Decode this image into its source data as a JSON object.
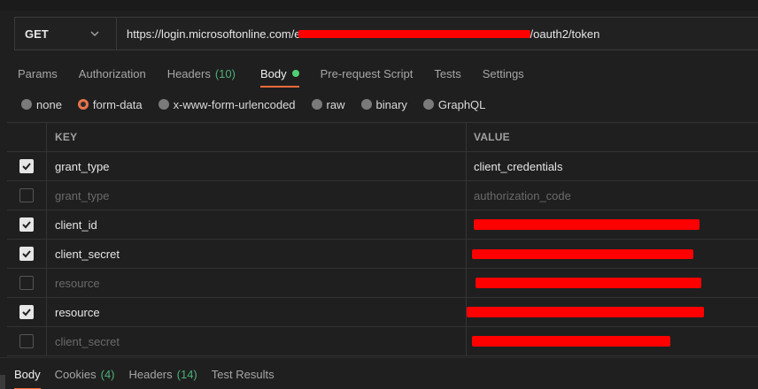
{
  "request": {
    "method": "GET",
    "url_prefix": "https://login.microsoftonline.com/e",
    "url_suffix": "/oauth2/token"
  },
  "tabs": [
    {
      "label": "Params"
    },
    {
      "label": "Authorization"
    },
    {
      "label": "Headers",
      "count": "(10)"
    },
    {
      "label": "Body"
    },
    {
      "label": "Pre-request Script"
    },
    {
      "label": "Tests"
    },
    {
      "label": "Settings"
    }
  ],
  "body_types": {
    "none": "none",
    "form_data": "form-data",
    "urlencoded": "x-www-form-urlencoded",
    "raw": "raw",
    "binary": "binary",
    "graphql": "GraphQL"
  },
  "table": {
    "key_header": "KEY",
    "value_header": "VALUE",
    "rows": [
      {
        "key": "grant_type",
        "value": "client_credentials"
      },
      {
        "key": "grant_type",
        "value": "authorization_code"
      },
      {
        "key": "client_id",
        "value": ""
      },
      {
        "key": "client_secret",
        "value": ""
      },
      {
        "key": "resource",
        "value": ""
      },
      {
        "key": "resource",
        "value": ""
      },
      {
        "key": "client_secret",
        "value": ""
      }
    ]
  },
  "bottom_tabs": [
    {
      "label": "Body"
    },
    {
      "label": "Cookies",
      "count": "(4)"
    },
    {
      "label": "Headers",
      "count": "(14)"
    },
    {
      "label": "Test Results"
    }
  ],
  "colors": {
    "accent": "#f26b3a",
    "count_green": "#4caf79",
    "redaction": "#ff0000"
  }
}
